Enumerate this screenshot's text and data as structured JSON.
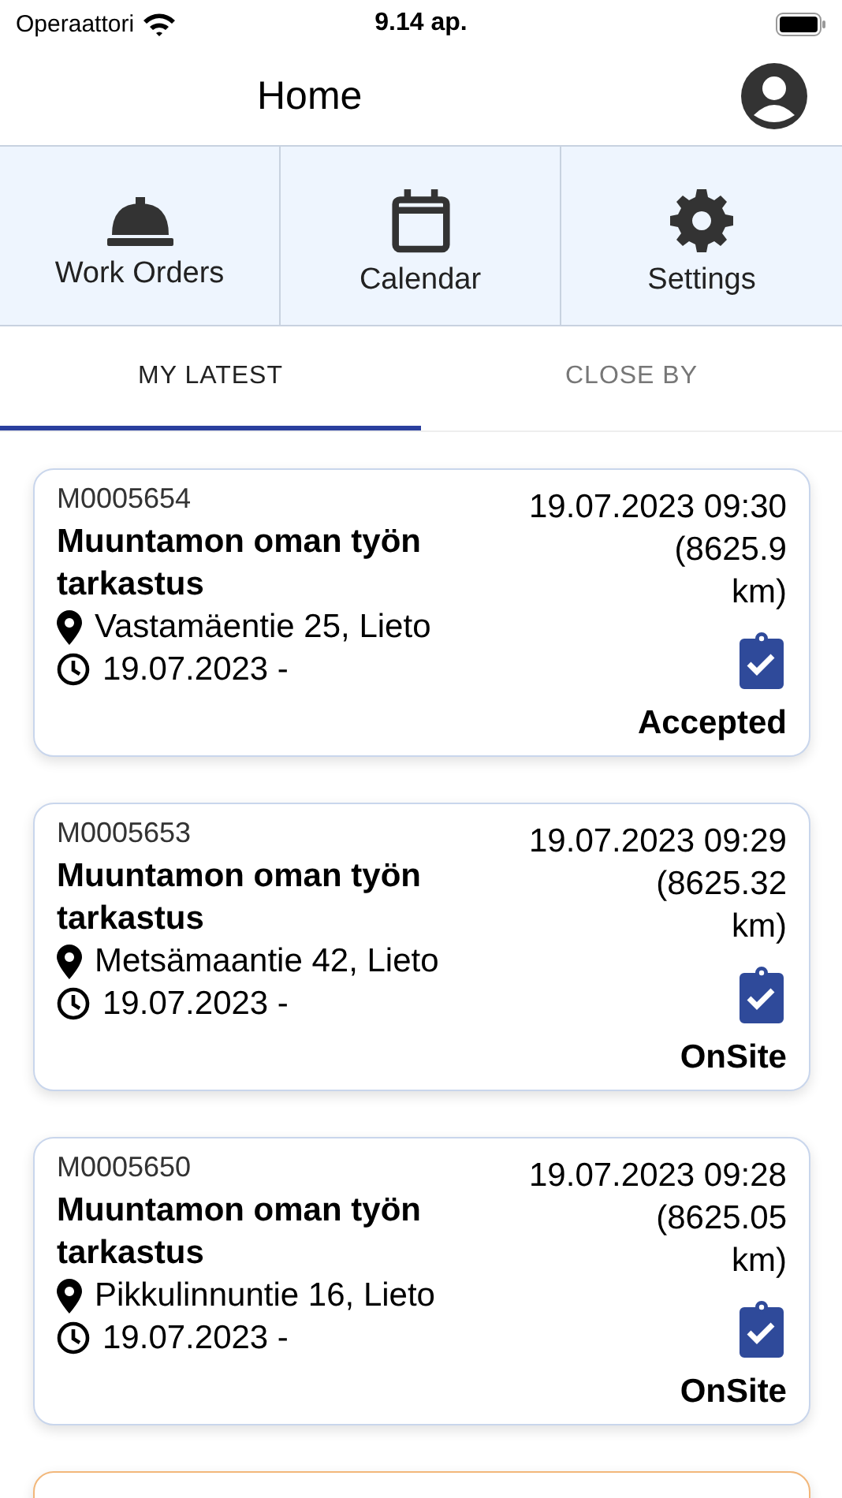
{
  "status_bar": {
    "carrier": "Operaattori",
    "time": "9.14 ap."
  },
  "header": {
    "title": "Home"
  },
  "nav": [
    {
      "kind": "helmet",
      "label": "Work Orders"
    },
    {
      "kind": "calendar",
      "label": "Calendar"
    },
    {
      "kind": "gear",
      "label": "Settings"
    }
  ],
  "tabs": [
    {
      "label": "MY LATEST",
      "selected": true
    },
    {
      "label": "CLOSE BY",
      "selected": false
    }
  ],
  "cards": [
    {
      "id": "M0005654",
      "title": "Muuntamon oman työn tarkastus",
      "address": "Vastamäentie 25, Lieto",
      "date": "19.07.2023 -",
      "timestamp": "19.07.2023 09:30",
      "distance": "(8625.9 km)",
      "status": "Accepted",
      "color": "#c9d6ec"
    },
    {
      "id": "M0005653",
      "title": "Muuntamon oman työn tarkastus",
      "address": "Metsämaantie 42, Lieto",
      "date": "19.07.2023 -",
      "timestamp": "19.07.2023 09:29",
      "distance": "(8625.32 km)",
      "status": "OnSite",
      "color": "#c9d6ec"
    },
    {
      "id": "M0005650",
      "title": "Muuntamon oman työn tarkastus",
      "address": "Pikkulinnuntie 16, Lieto",
      "date": "19.07.2023 -",
      "timestamp": "19.07.2023 09:28",
      "distance": "(8625.05 km)",
      "status": "OnSite",
      "color": "#c9d6ec"
    },
    {
      "color": "#f2b77a"
    }
  ]
}
